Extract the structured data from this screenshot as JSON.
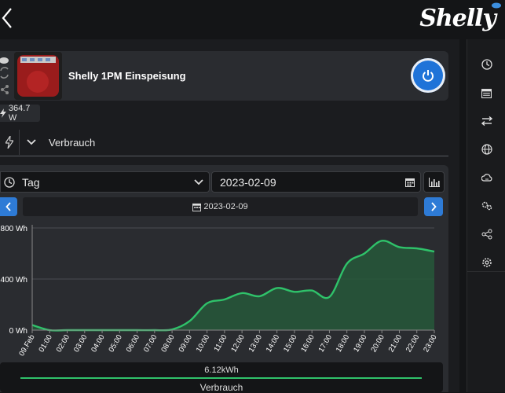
{
  "header": {
    "logo_text": "Shelly"
  },
  "device": {
    "name": "Shelly 1PM Einspeisung",
    "power_reading": "364.7 W"
  },
  "tabs": {
    "active_label": "Verbrauch"
  },
  "controls": {
    "period": "Tag",
    "date_value": "2023-02-09",
    "date_display": "2023-02-09"
  },
  "summary": {
    "total": "6.12kWh",
    "label": "Verbrauch"
  },
  "rail": {
    "items": [
      "clock-icon",
      "calendar-icon",
      "swap-arrows-icon",
      "globe-icon",
      "cloud-ratio-icon",
      "gears-icon",
      "share-icon",
      "settings-gear-icon"
    ]
  },
  "colors": {
    "accent_blue": "#1f73d8",
    "series_green": "#2fc26a",
    "fill_green": "#26583a"
  },
  "chart_data": {
    "type": "area",
    "categories": [
      "09.Feb",
      "01:00",
      "02:00",
      "03:00",
      "04:00",
      "05:00",
      "06:00",
      "07:00",
      "08:00",
      "09:00",
      "10:00",
      "11:00",
      "12:00",
      "13:00",
      "14:00",
      "15:00",
      "16:00",
      "17:00",
      "18:00",
      "19:00",
      "20:00",
      "21:00",
      "22:00",
      "23:00"
    ],
    "series": [
      {
        "values": [
          40,
          0,
          0,
          0,
          0,
          0,
          0,
          0,
          5,
          70,
          210,
          240,
          290,
          265,
          330,
          300,
          310,
          260,
          520,
          600,
          700,
          650,
          640,
          615
        ]
      }
    ],
    "y_ticks": [
      "0 Wh",
      "400 Wh",
      "800 Wh"
    ],
    "ylim": [
      0,
      800
    ],
    "grid": true
  }
}
